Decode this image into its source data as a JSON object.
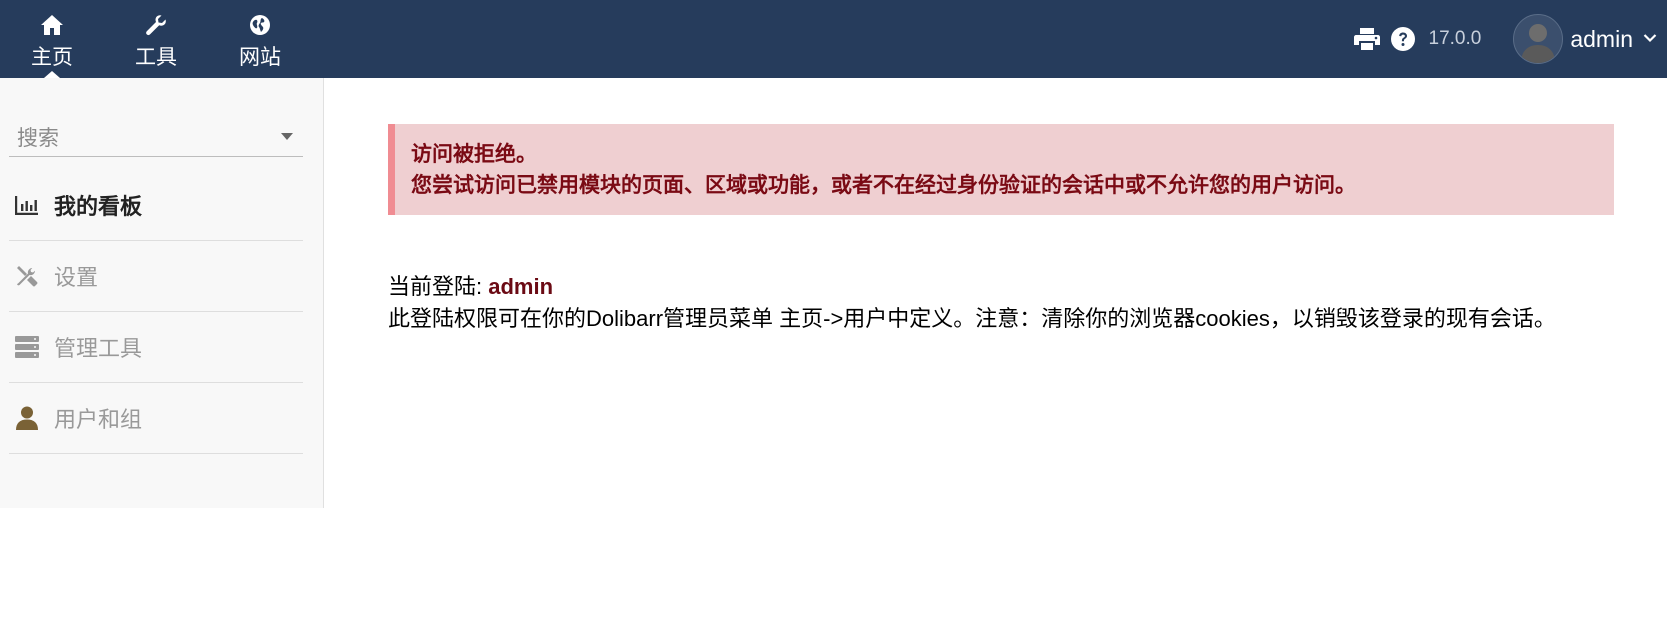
{
  "topmenu": [
    {
      "label": "主页",
      "icon": "home-icon"
    },
    {
      "label": "工具",
      "icon": "wrench-icon"
    },
    {
      "label": "网站",
      "icon": "globe-icon"
    }
  ],
  "toolbar": {
    "print_icon": "print-icon",
    "help_icon": "help-icon",
    "version": "17.0.0",
    "username": "admin"
  },
  "sidebar": {
    "search_placeholder": "搜索",
    "items": [
      {
        "label": "我的看板",
        "icon": "bar-chart-icon",
        "active": true
      },
      {
        "label": "设置",
        "icon": "tools-icon"
      },
      {
        "label": "管理工具",
        "icon": "server-icon"
      },
      {
        "label": "用户和组",
        "icon": "user-icon"
      }
    ]
  },
  "alert": {
    "title": "访问被拒绝。",
    "message": "您尝试访问已禁用模块的页面、区域或功能，或者不在经过身份验证的会话中或不允许您的用户访问。"
  },
  "login_info": {
    "label": "当前登陆: ",
    "user": "admin",
    "note": "此登陆权限可在你的Dolibarr管理员菜单 主页->用户中定义。注意：清除你的浏览器cookies，以销毁该登录的现有会话。"
  },
  "colors": {
    "topbar": "#263c5c",
    "alert_bg": "#efcfd1",
    "alert_border": "#f08c92",
    "alert_text": "#7a0a14",
    "user_accent": "#6b0a14"
  }
}
